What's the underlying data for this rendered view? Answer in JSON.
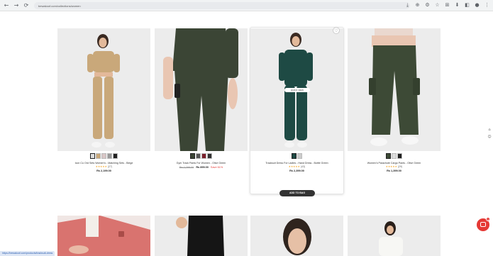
{
  "browser": {
    "url": "bewakoof.com/collections/women",
    "nav": [
      "←",
      "→",
      "⟳"
    ],
    "toolbar_icons": [
      "⤓",
      "⊕",
      "⚙",
      "☆",
      "⊞",
      "⬇",
      "◧",
      "●",
      "⋮"
    ]
  },
  "products": [
    {
      "name": "Icon Co Ord Sets Women's - Matching Sets - Beige",
      "stars": "★★★★★",
      "reviews": "(27)",
      "price": "Rs 2,199.00",
      "mrp": "",
      "discount": ""
    },
    {
      "name": "Gym Track Pants For Women - Olive Green",
      "stars": "",
      "reviews": "",
      "price": "Rs 899.00",
      "mrp": "Rs 2,299.00",
      "discount": "Save 61%"
    },
    {
      "name": "Tracksuit Dress For Ladies - Hand Dress - Bottle Green",
      "stars": "★★★★★",
      "reviews": "(43)",
      "price": "Rs 2,399.00",
      "mrp": "",
      "discount": ""
    },
    {
      "name": "Women's Parachute Cargo Pants - Olive Green",
      "stars": "★★★★★",
      "reviews": "(29)",
      "price": "Rs 1,399.00",
      "mrp": "",
      "discount": ""
    }
  ],
  "quick_view_label": "QUICK VIEW",
  "add_to_bag_label": "ADD TO BAG",
  "status_url": "https://bewakoof.com/products/tracksuit-dress",
  "chat_badge": "1",
  "colors": {
    "beige": "#c9a87a",
    "olive": "#3b4535",
    "bottle_green": "#1e4a44",
    "accent_red": "#e53935"
  }
}
